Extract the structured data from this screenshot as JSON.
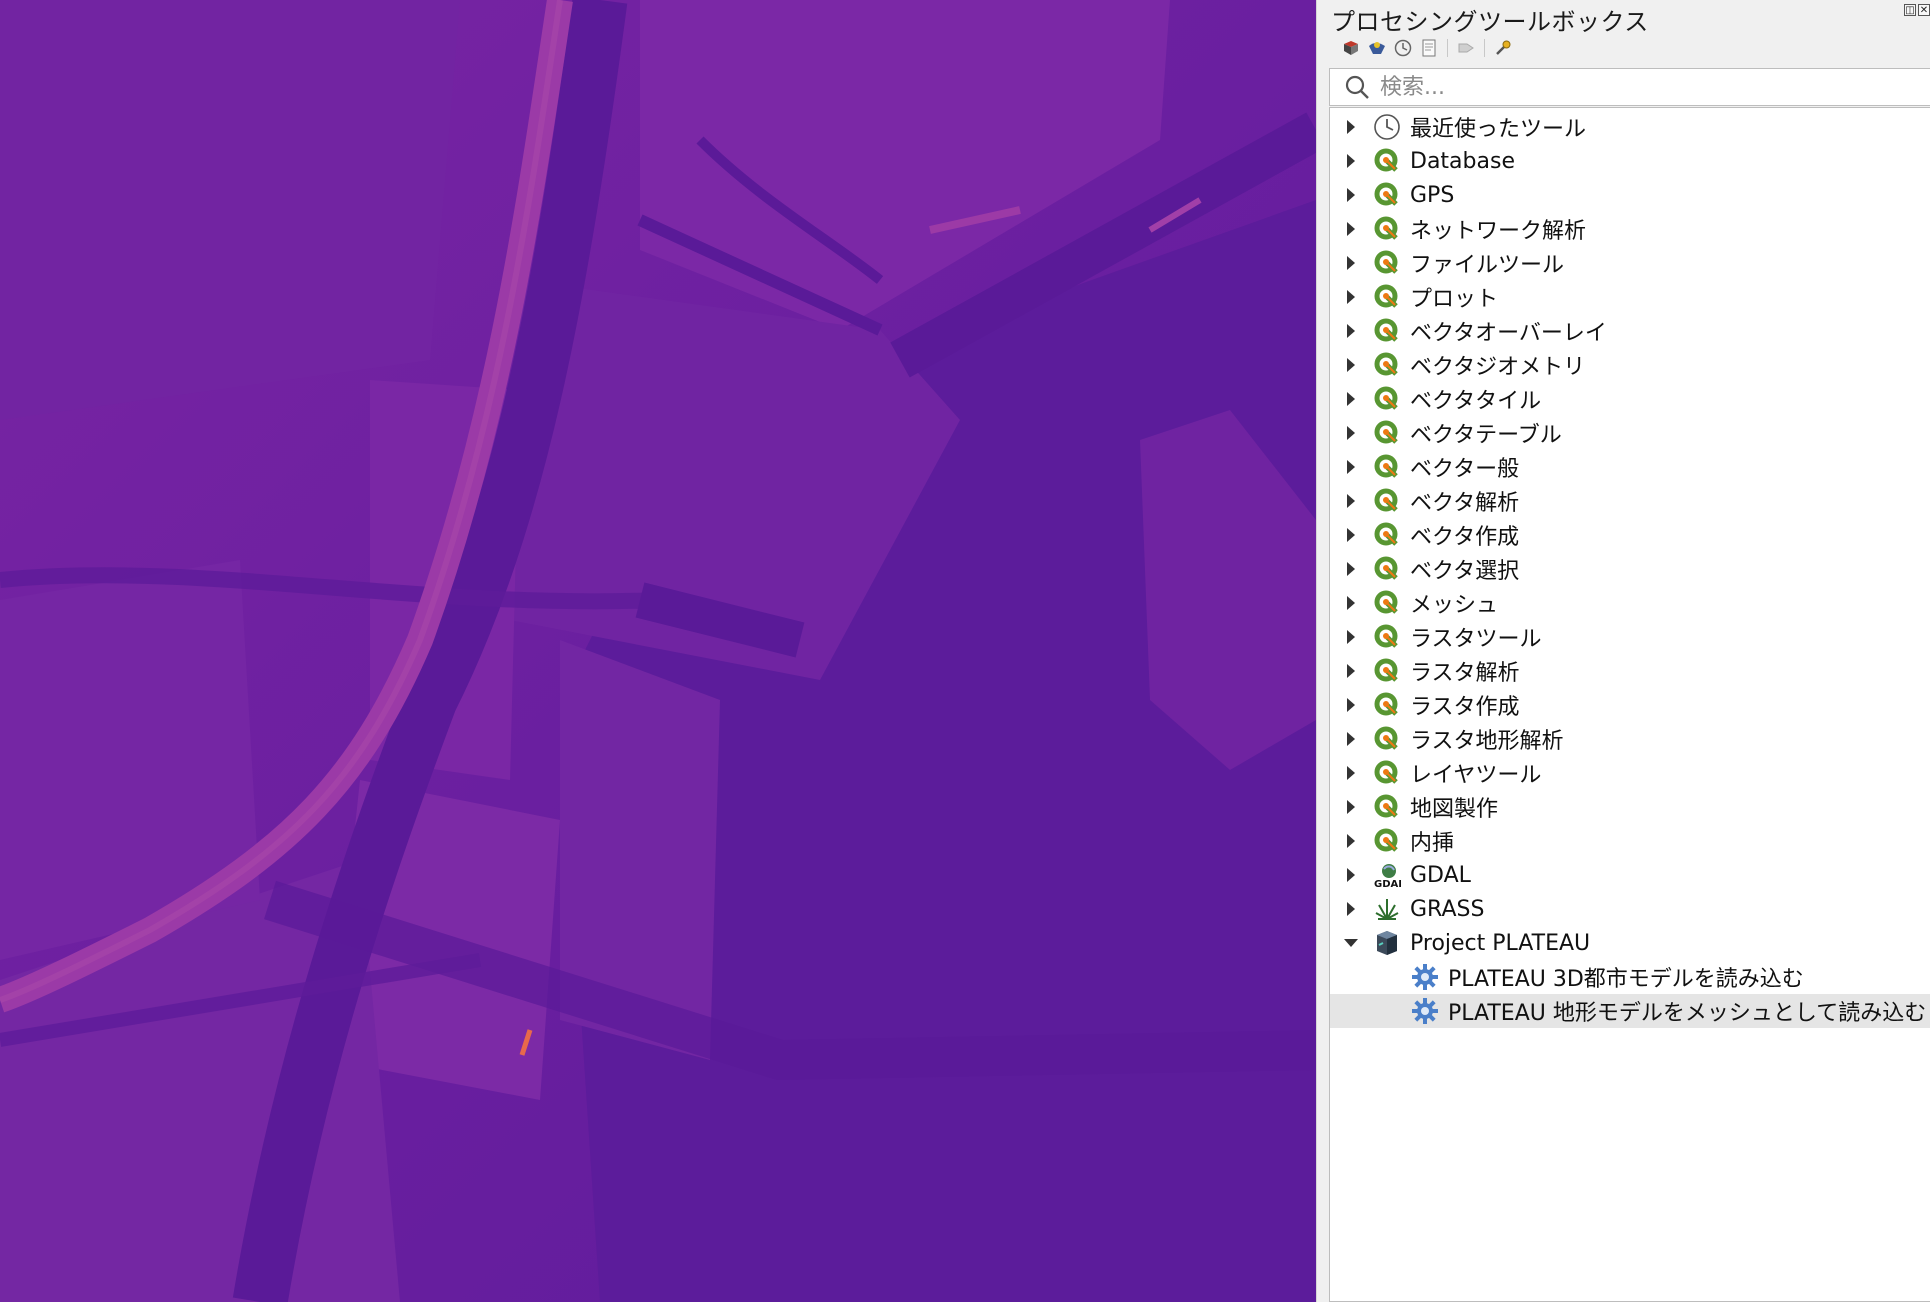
{
  "panel": {
    "title": "プロセシングツールボックス",
    "dock_float": "◫",
    "dock_close": "✕"
  },
  "toolbar": {
    "items": [
      "models-icon",
      "scripts-icon",
      "history-icon",
      "results-icon",
      "edit-in-place-icon",
      "options-icon"
    ]
  },
  "search": {
    "placeholder": "検索..."
  },
  "tree": {
    "groups": [
      {
        "label": "最近使ったツール",
        "icon": "clock-icon",
        "expanded": false
      },
      {
        "label": "Database",
        "icon": "qgis-icon",
        "expanded": false
      },
      {
        "label": "GPS",
        "icon": "qgis-icon",
        "expanded": false
      },
      {
        "label": "ネットワーク解析",
        "icon": "qgis-icon",
        "expanded": false
      },
      {
        "label": "ファイルツール",
        "icon": "qgis-icon",
        "expanded": false
      },
      {
        "label": "プロット",
        "icon": "qgis-icon",
        "expanded": false
      },
      {
        "label": "ベクタオーバーレイ",
        "icon": "qgis-icon",
        "expanded": false
      },
      {
        "label": "ベクタジオメトリ",
        "icon": "qgis-icon",
        "expanded": false
      },
      {
        "label": "ベクタタイル",
        "icon": "qgis-icon",
        "expanded": false
      },
      {
        "label": "ベクタテーブル",
        "icon": "qgis-icon",
        "expanded": false
      },
      {
        "label": "ベクター般",
        "icon": "qgis-icon",
        "expanded": false
      },
      {
        "label": "ベクタ解析",
        "icon": "qgis-icon",
        "expanded": false
      },
      {
        "label": "ベクタ作成",
        "icon": "qgis-icon",
        "expanded": false
      },
      {
        "label": "ベクタ選択",
        "icon": "qgis-icon",
        "expanded": false
      },
      {
        "label": "メッシュ",
        "icon": "qgis-icon",
        "expanded": false
      },
      {
        "label": "ラスタツール",
        "icon": "qgis-icon",
        "expanded": false
      },
      {
        "label": "ラスタ解析",
        "icon": "qgis-icon",
        "expanded": false
      },
      {
        "label": "ラスタ作成",
        "icon": "qgis-icon",
        "expanded": false
      },
      {
        "label": "ラスタ地形解析",
        "icon": "qgis-icon",
        "expanded": false
      },
      {
        "label": "レイヤツール",
        "icon": "qgis-icon",
        "expanded": false
      },
      {
        "label": "地図製作",
        "icon": "qgis-icon",
        "expanded": false
      },
      {
        "label": "内挿",
        "icon": "qgis-icon",
        "expanded": false
      },
      {
        "label": "GDAL",
        "icon": "gdal-icon",
        "expanded": false
      },
      {
        "label": "GRASS",
        "icon": "grass-icon",
        "expanded": false
      },
      {
        "label": "Project PLATEAU",
        "icon": "plateau-icon",
        "expanded": true
      }
    ],
    "plateau_children": [
      {
        "label": "PLATEAU 3D都市モデルを読み込む",
        "icon": "gear-icon",
        "selected": false
      },
      {
        "label": "PLATEAU 地形モデルをメッシュとして読み込む",
        "icon": "gear-icon",
        "selected": true
      }
    ]
  },
  "colors": {
    "map_base": "#6a1fa0",
    "map_dark": "#5b1b9a",
    "map_light": "#8a2fa5",
    "map_road": "#9c3aa6",
    "qgis_green": "#589632",
    "qgis_yellow": "#ee7913",
    "selection": "#e5e5e5"
  }
}
